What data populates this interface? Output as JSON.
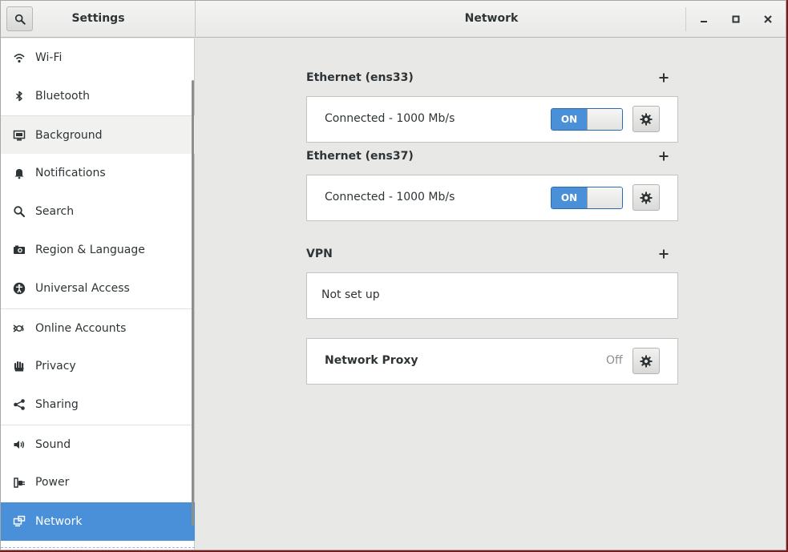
{
  "header": {
    "sidebar_title": "Settings",
    "title": "Network"
  },
  "window_controls": {
    "minimize": "minimize-icon",
    "maximize": "maximize-icon",
    "close": "close-icon"
  },
  "sidebar": {
    "items": [
      {
        "label": "Wi-Fi",
        "icon": "wifi-icon"
      },
      {
        "label": "Bluetooth",
        "icon": "bluetooth-icon"
      },
      {
        "label": "Background",
        "icon": "background-icon"
      },
      {
        "label": "Notifications",
        "icon": "bell-icon"
      },
      {
        "label": "Search",
        "icon": "search-icon"
      },
      {
        "label": "Region & Language",
        "icon": "camera-icon"
      },
      {
        "label": "Universal Access",
        "icon": "accessibility-icon"
      },
      {
        "label": "Online Accounts",
        "icon": "online-accounts-icon"
      },
      {
        "label": "Privacy",
        "icon": "hand-icon"
      },
      {
        "label": "Sharing",
        "icon": "share-icon"
      },
      {
        "label": "Sound",
        "icon": "speaker-icon"
      },
      {
        "label": "Power",
        "icon": "power-plug-icon"
      },
      {
        "label": "Network",
        "icon": "network-icon"
      }
    ],
    "selected": "Network"
  },
  "main": {
    "ethernet1": {
      "title": "Ethernet (ens33)",
      "status": "Connected - 1000 Mb/s",
      "switch_label": "ON"
    },
    "ethernet2": {
      "title": "Ethernet (ens37)",
      "status": "Connected - 1000 Mb/s",
      "switch_label": "ON"
    },
    "vpn": {
      "title": "VPN",
      "status": "Not set up"
    },
    "proxy": {
      "label": "Network Proxy",
      "value": "Off"
    }
  },
  "colors": {
    "accent": "#4a90d9",
    "window_bg": "#e8e8e7"
  }
}
